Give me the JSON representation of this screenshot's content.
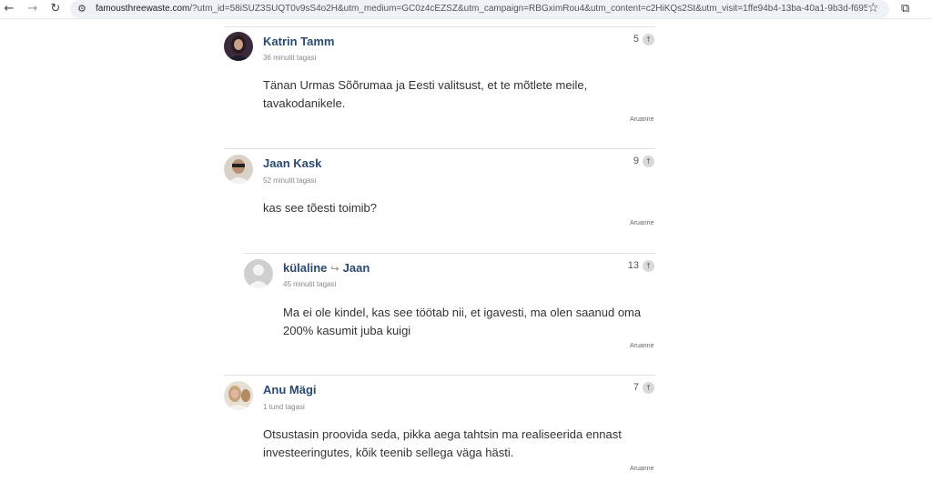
{
  "browser": {
    "url_host": "famousthreewaste.com",
    "url_rest": "/?utm_id=58iSUZ3SUQT0v9sS4o2H&utm_medium=GC0z4cEZSZ&utm_campaign=RBGximRou4&utm_content=c2HiKQs2St&utm_visit=1ffe94b4-13ba-40a1-9b3d-f695d..."
  },
  "report_label": "Aruanne",
  "comments": [
    {
      "author": "Katrin Tamm",
      "time": "36 minutit tagasi",
      "body": "Tänan Urmas Sõõrumaa ja Eesti valitsust, et te mõtlete meile, tavakodanikele.",
      "votes": "5"
    },
    {
      "author": "Jaan Kask",
      "time": "52 minutit tagasi",
      "body": "kas see tõesti toimib?",
      "votes": "9"
    },
    {
      "author": "külaline",
      "reply_to": "Jaan",
      "time": "45 minutit tagasi",
      "body": "Ma ei ole kindel, kas see töötab nii, et igavesti, ma olen saanud oma 200% kasumit juba kuigi",
      "votes": "13"
    },
    {
      "author": "Anu Mägi",
      "time": "1 tund tagasi",
      "body": "Otsustasin proovida seda, pikka aega tahtsin ma realiseerida ennast investeeringutes, kõik teenib sellega väga hästi.",
      "votes": "7"
    }
  ]
}
